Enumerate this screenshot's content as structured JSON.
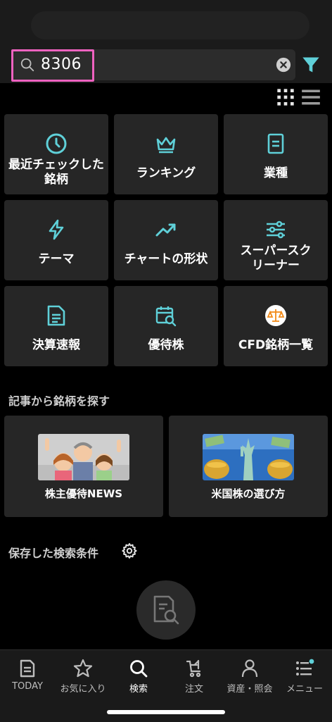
{
  "search": {
    "value": "8306"
  },
  "tiles": [
    {
      "label": "最近チェックした銘柄",
      "icon": "clock-icon"
    },
    {
      "label": "ランキング",
      "icon": "crown-icon"
    },
    {
      "label": "業種",
      "icon": "document-icon"
    },
    {
      "label": "テーマ",
      "icon": "lightning-icon"
    },
    {
      "label": "チャートの形状",
      "icon": "trend-up-icon"
    },
    {
      "label": "スーパースクリーナー",
      "icon": "sliders-icon"
    },
    {
      "label": "決算速報",
      "icon": "report-icon"
    },
    {
      "label": "優待株",
      "icon": "calendar-search-icon"
    },
    {
      "label": "CFD銘柄一覧",
      "icon": "scale-icon"
    }
  ],
  "articles": {
    "title": "記事から銘柄を探す",
    "items": [
      {
        "label": "株主優待NEWS"
      },
      {
        "label": "米国株の選び方"
      }
    ]
  },
  "saved": {
    "title": "保存した検索条件"
  },
  "nav": [
    {
      "label": "TODAY",
      "icon": "today-icon",
      "active": false
    },
    {
      "label": "お気に入り",
      "icon": "star-icon",
      "active": false
    },
    {
      "label": "検索",
      "icon": "search-icon",
      "active": true
    },
    {
      "label": "注文",
      "icon": "cart-icon",
      "active": false
    },
    {
      "label": "資産・照会",
      "icon": "person-icon",
      "active": false
    },
    {
      "label": "メニュー",
      "icon": "menu-icon",
      "active": false
    }
  ],
  "colors": {
    "accent": "#5fd0d8",
    "highlight": "#ef62c0",
    "tile_bg": "#262626",
    "background": "#000000"
  }
}
